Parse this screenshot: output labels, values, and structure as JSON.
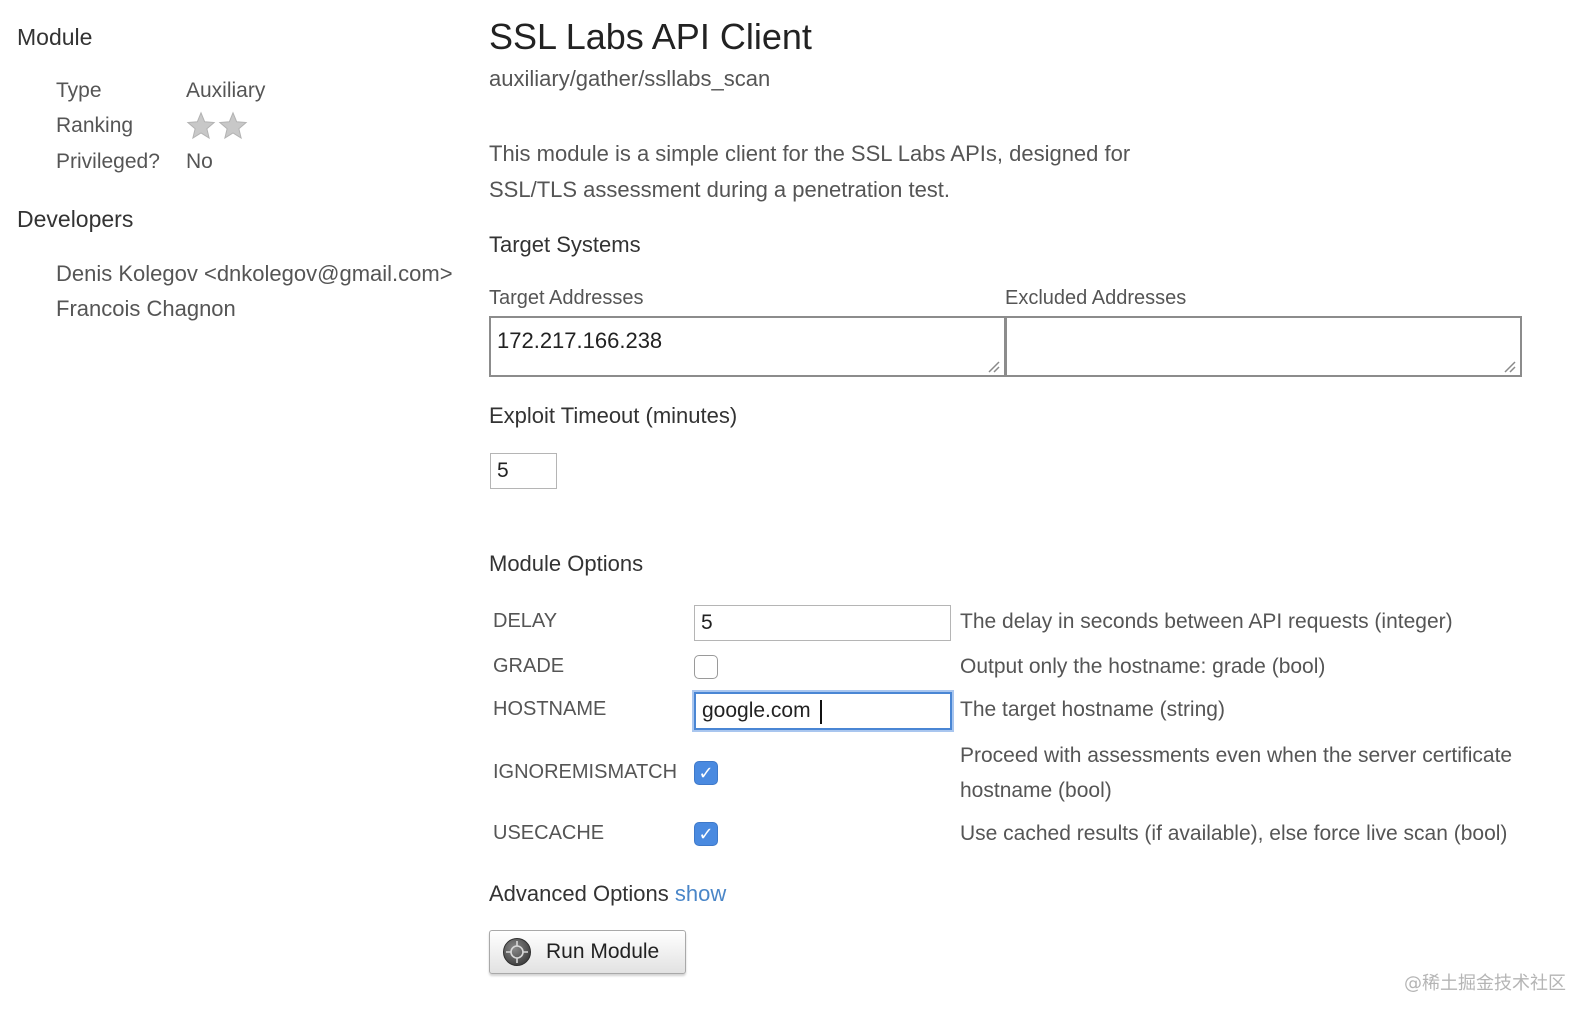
{
  "sidebar": {
    "module_heading": "Module",
    "meta": [
      {
        "label": "Type",
        "value": "Auxiliary"
      },
      {
        "label": "Ranking",
        "stars": 2
      },
      {
        "label": "Privileged?",
        "value": "No"
      }
    ],
    "developers_heading": "Developers",
    "developers": [
      "Denis Kolegov <dnkolegov@gmail.com>",
      "Francois Chagnon"
    ]
  },
  "main": {
    "title": "SSL Labs API Client",
    "path": "auxiliary/gather/ssllabs_scan",
    "description": "This module is a simple client for the SSL Labs APIs, designed for SSL/TLS assessment during a penetration test.",
    "target_systems": {
      "heading": "Target Systems",
      "target_label": "Target Addresses",
      "target_value": "172.217.166.238",
      "excluded_label": "Excluded Addresses",
      "excluded_value": ""
    },
    "timeout": {
      "heading": "Exploit Timeout (minutes)",
      "value": "5"
    },
    "module_options": {
      "heading": "Module Options",
      "options": [
        {
          "name": "DELAY",
          "kind": "text",
          "value": "5",
          "description": "The delay in seconds between API requests (integer)"
        },
        {
          "name": "GRADE",
          "kind": "checkbox",
          "checked": false,
          "description": "Output only the hostname: grade (bool)"
        },
        {
          "name": "HOSTNAME",
          "kind": "text",
          "value": "google.com",
          "focused": true,
          "description": "The target hostname (string)"
        },
        {
          "name": "IGNOREMISMATCH",
          "kind": "checkbox",
          "checked": true,
          "description_line1": "Proceed with assessments even when the server certificate",
          "description_line2": "hostname (bool)"
        },
        {
          "name": "USECACHE",
          "kind": "checkbox",
          "checked": true,
          "description": "Use cached results (if available), else force live scan (bool)"
        }
      ]
    },
    "advanced": {
      "label": "Advanced Options",
      "link": "show"
    },
    "run_button": {
      "label": "Run Module"
    }
  },
  "watermark": "@稀土掘金技术社区",
  "colors": {
    "accent": "#4a86c8",
    "checkbox_checked": "#4a8ae0",
    "focus_ring": "#4a86d4"
  }
}
